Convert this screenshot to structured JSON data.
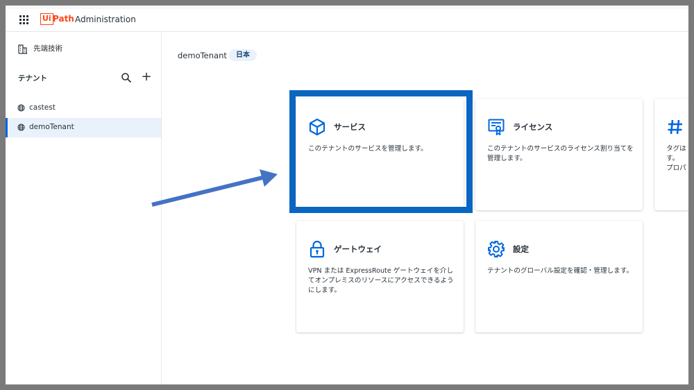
{
  "header": {
    "logo_ui": "Ui",
    "logo_path": "Path",
    "app_title": "Administration",
    "apps_icon": "apps-grid-icon"
  },
  "sidebar": {
    "org_name": "先端技術",
    "tenants_header": "テナント",
    "tenants": [
      {
        "name": "castest",
        "active": false
      },
      {
        "name": "demoTenant",
        "active": true
      }
    ]
  },
  "main": {
    "tenant_title": "demoTenant",
    "region_badge": "日本",
    "cards": [
      {
        "title": "サービス",
        "description": "このテナントのサービスを管理します。",
        "icon": "cube-icon"
      },
      {
        "title": "ライセンス",
        "description": "このテナントのサービスのライセンス割り当てを管理します。",
        "icon": "license-certificate-icon"
      },
      {
        "title": "",
        "description": "タグは\nす。\nプロパ",
        "icon": "hash-icon"
      },
      {
        "title": "ゲートウェイ",
        "description": "VPN または ExpressRoute ゲートウェイを介してオンプレミスのリソースにアクセスできるようにします。",
        "icon": "lock-icon"
      },
      {
        "title": "設定",
        "description": "テナントのグローバル設定を確認・管理します。",
        "icon": "gear-icon"
      }
    ]
  },
  "colors": {
    "accent": "#0067df",
    "brand": "#fa4616",
    "highlight_border": "#0b66c1",
    "arrow": "#4472c4"
  }
}
